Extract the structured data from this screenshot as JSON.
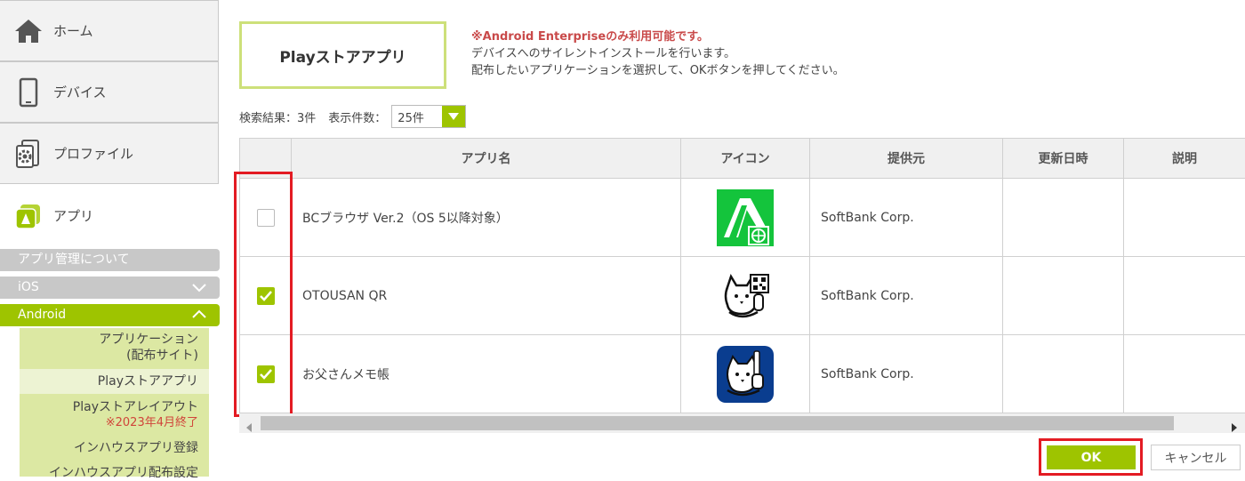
{
  "sidebar": {
    "nav": [
      {
        "label": "ホーム",
        "icon": "home-icon"
      },
      {
        "label": "デバイス",
        "icon": "smartphone-icon"
      },
      {
        "label": "プロファイル",
        "icon": "profile-gear-icon"
      },
      {
        "label": "アプリ",
        "icon": "app-icon"
      }
    ],
    "app_management_label": "アプリ管理について",
    "ios_label": "iOS",
    "android_label": "Android",
    "android_sub": [
      {
        "label": "アプリケーション\n(配布サイト)"
      },
      {
        "label": "Playストアアプリ"
      },
      {
        "label": "Playストアレイアウト",
        "note": "※2023年4月終了"
      },
      {
        "label": "インハウスアプリ登録"
      },
      {
        "label": "インハウスアプリ配布設定"
      }
    ]
  },
  "page": {
    "title": "Playストアアプリ",
    "notice_warning": "※Android Enterpriseのみ利用可能です。",
    "notice_line1": "デバイスへのサイレントインストールを行います。",
    "notice_line2": "配布したいアプリケーションを選択して、OKボタンを押してください。"
  },
  "search": {
    "result_label": "検索結果：3件",
    "per_page_label": "表示件数：",
    "per_page_value": "25件"
  },
  "table": {
    "headers": {
      "name": "アプリ名",
      "icon": "アイコン",
      "provider": "提供元",
      "updated": "更新日時",
      "description": "説明"
    },
    "rows": [
      {
        "name": "BCブラウザ Ver.2（OS 5以降対象）",
        "icon": "bc-browser-icon",
        "provider": "SoftBank Corp.",
        "updated": "",
        "description": "",
        "checked": false
      },
      {
        "name": "OTOUSAN QR",
        "icon": "otousan-qr-icon",
        "provider": "SoftBank Corp.",
        "updated": "",
        "description": "",
        "checked": true
      },
      {
        "name": "お父さんメモ帳",
        "icon": "otousan-memo-icon",
        "provider": "SoftBank Corp.",
        "updated": "",
        "description": "",
        "checked": true
      }
    ]
  },
  "buttons": {
    "ok": "OK",
    "cancel": "キャンセル"
  },
  "colors": {
    "accent": "#9ec400",
    "highlight": "#e31b23",
    "warning": "#c94a4a"
  }
}
